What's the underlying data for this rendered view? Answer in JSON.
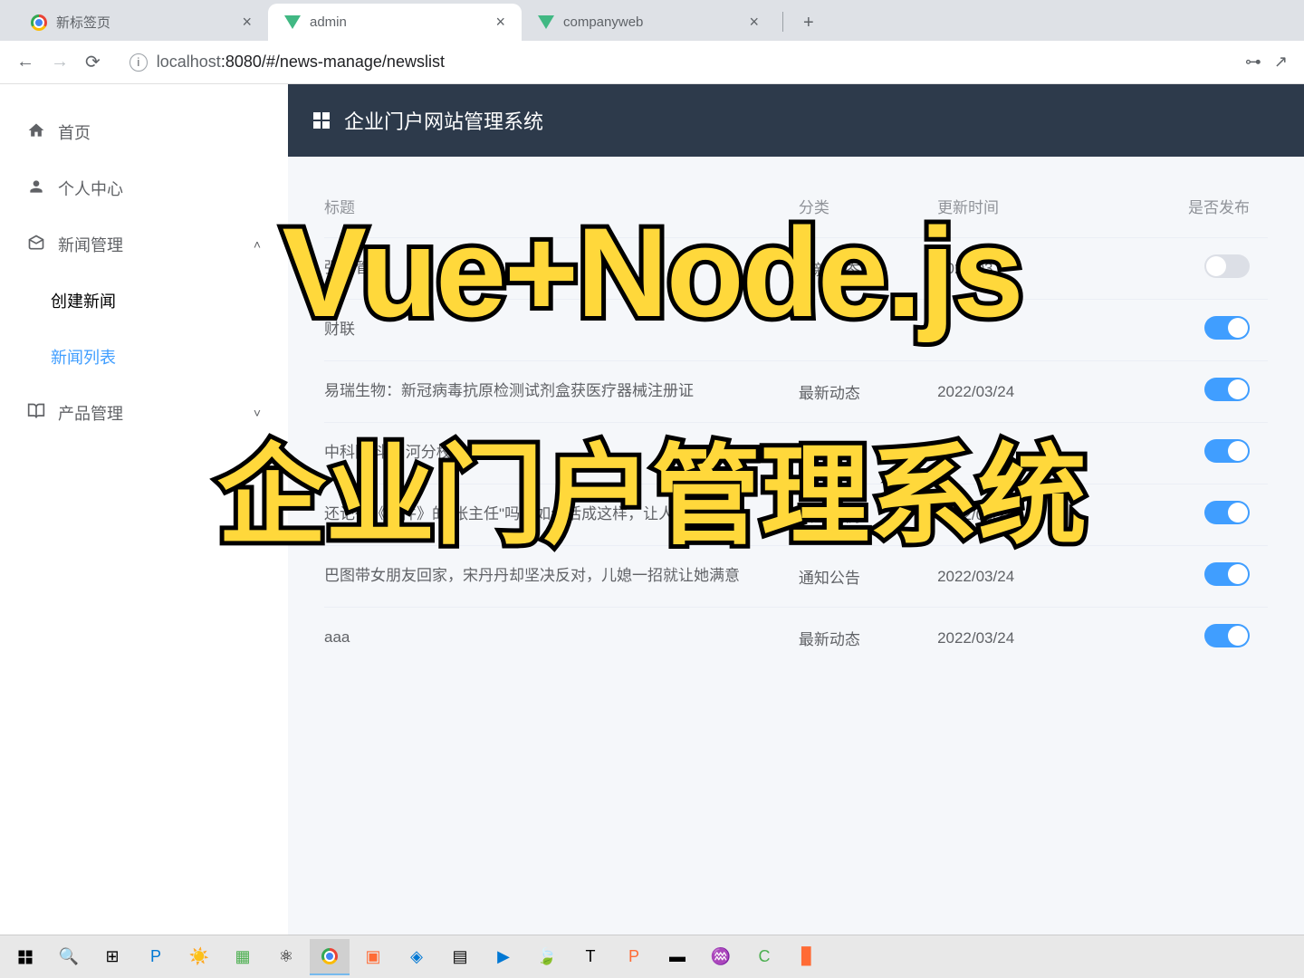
{
  "browser": {
    "tabs": [
      {
        "title": "新标签页",
        "icon": "chrome"
      },
      {
        "title": "admin",
        "icon": "vue",
        "active": true
      },
      {
        "title": "companyweb",
        "icon": "vue"
      }
    ],
    "url_host": "localhost",
    "url_port": ":8080",
    "url_path": "/#/news-manage/newslist"
  },
  "sidebar": {
    "home": "首页",
    "profile": "个人中心",
    "news_manage": "新闻管理",
    "create_news": "创建新闻",
    "news_list": "新闻列表",
    "product_manage": "产品管理"
  },
  "header": {
    "title": "企业门户网站管理系统"
  },
  "table": {
    "headers": {
      "title": "标题",
      "category": "分类",
      "updated": "更新时间",
      "published": "是否发布"
    },
    "rows": [
      {
        "title": "强化管理",
        "category": "最新动态",
        "updated": "2022/03",
        "published": false
      },
      {
        "title": "财联",
        "category": "",
        "updated": "",
        "published": true
      },
      {
        "title": "易瑞生物：新冠病毒抗原检测试剂盒获医疗器械注册证",
        "category": "最新动态",
        "updated": "2022/03/24",
        "published": true
      },
      {
        "title": "中科院科技 河分校",
        "category": "",
        "updated": "",
        "published": true
      },
      {
        "title": "还记得《事件》的\"张主任\"吗？如今活成这样，让人感慨",
        "category": "典型案例",
        "updated": "2022/03/24",
        "published": true
      },
      {
        "title": "巴图带女朋友回家，宋丹丹却坚决反对，儿媳一招就让她满意",
        "category": "通知公告",
        "updated": "2022/03/24",
        "published": true
      },
      {
        "title": "aaa",
        "category": "最新动态",
        "updated": "2022/03/24",
        "published": true
      }
    ]
  },
  "overlay": {
    "line1": "Vue+Node.js",
    "line2": "企业门户管理系统"
  }
}
